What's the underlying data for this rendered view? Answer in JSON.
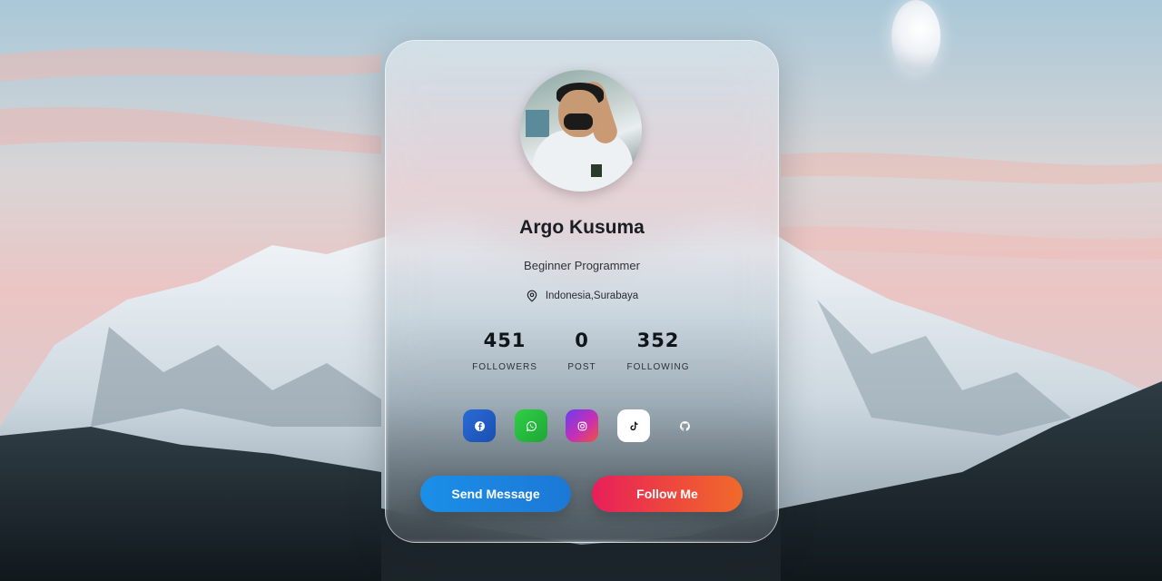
{
  "profile": {
    "name": "Argo Kusuma",
    "role": "Beginner Programmer",
    "location": "Indonesia,Surabaya"
  },
  "stats": [
    {
      "value": "451",
      "label": "FOLLOWERS"
    },
    {
      "value": "0",
      "label": "POST"
    },
    {
      "value": "352",
      "label": "FOLLOWING"
    }
  ],
  "socials": [
    {
      "icon": "facebook-icon",
      "color": "#1f5fc9"
    },
    {
      "icon": "whatsapp-icon",
      "color": "#22b43c"
    },
    {
      "icon": "instagram-icon",
      "color": "#b535c9"
    },
    {
      "icon": "tiktok-icon",
      "color": "#ffffff"
    },
    {
      "icon": "github-icon",
      "color": "transparent"
    }
  ],
  "buttons": {
    "send_label": "Send Message",
    "follow_label": "Follow Me"
  },
  "colors": {
    "send": "#1b8fe8",
    "follow": "#e81f5b"
  }
}
